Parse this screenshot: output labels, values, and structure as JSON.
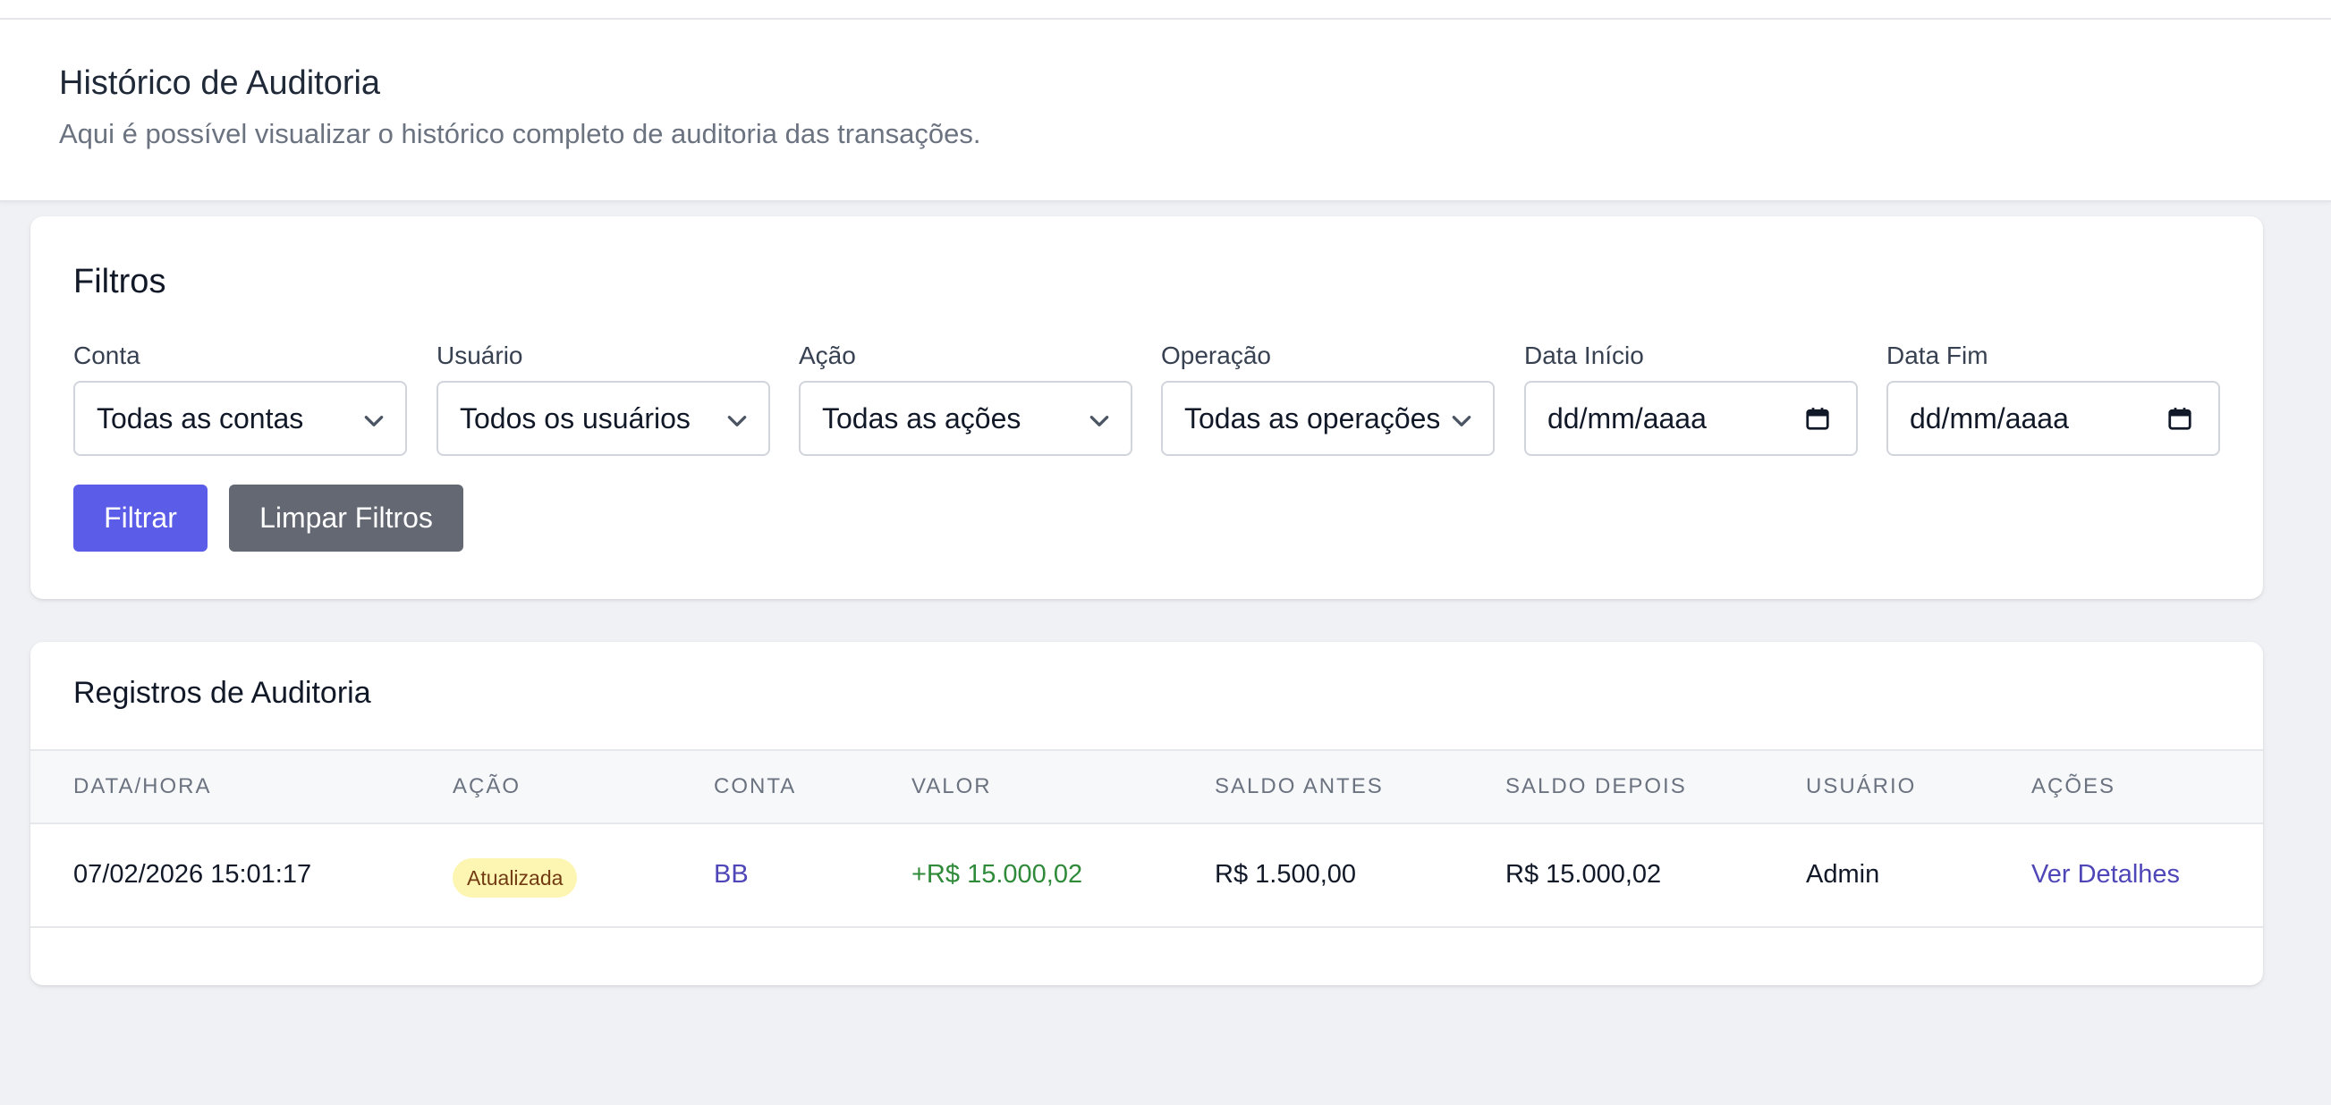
{
  "header": {
    "title": "Histórico de Auditoria",
    "subtitle": "Aqui é possível visualizar o histórico completo de auditoria das transações."
  },
  "filters": {
    "title": "Filtros",
    "fields": [
      {
        "label": "Conta",
        "value": "Todas as contas",
        "kind": "select"
      },
      {
        "label": "Usuário",
        "value": "Todos os usuários",
        "kind": "select"
      },
      {
        "label": "Ação",
        "value": "Todas as ações",
        "kind": "select"
      },
      {
        "label": "Operação",
        "value": "Todas as operações",
        "kind": "select"
      },
      {
        "label": "Data Início",
        "value": "dd/mm/aaaa",
        "kind": "date"
      },
      {
        "label": "Data Fim",
        "value": "dd/mm/aaaa",
        "kind": "date"
      }
    ],
    "filter_button": "Filtrar",
    "clear_button": "Limpar Filtros"
  },
  "records": {
    "title": "Registros de Auditoria",
    "columns": [
      "Data/Hora",
      "Ação",
      "Conta",
      "Valor",
      "Saldo Antes",
      "Saldo Depois",
      "Usuário",
      "Ações"
    ],
    "rows": [
      {
        "datetime": "07/02/2026 15:01:17",
        "action": "Atualizada",
        "account": "BB",
        "amount": "+R$ 15.000,02",
        "balance_before": "R$ 1.500,00",
        "balance_after": "R$ 15.000,02",
        "user": "Admin",
        "details_link": "Ver Detalhes"
      }
    ]
  },
  "colors": {
    "primary": "#5b5ce8",
    "secondary": "#636873",
    "link": "#4f46b8",
    "positive": "#2f8a3a",
    "badge_bg": "#fdf6b2",
    "badge_text": "#723b13",
    "page_bg": "#f0f1f5"
  },
  "icons": {
    "select": "chevron-down-icon",
    "date": "calendar-icon"
  }
}
